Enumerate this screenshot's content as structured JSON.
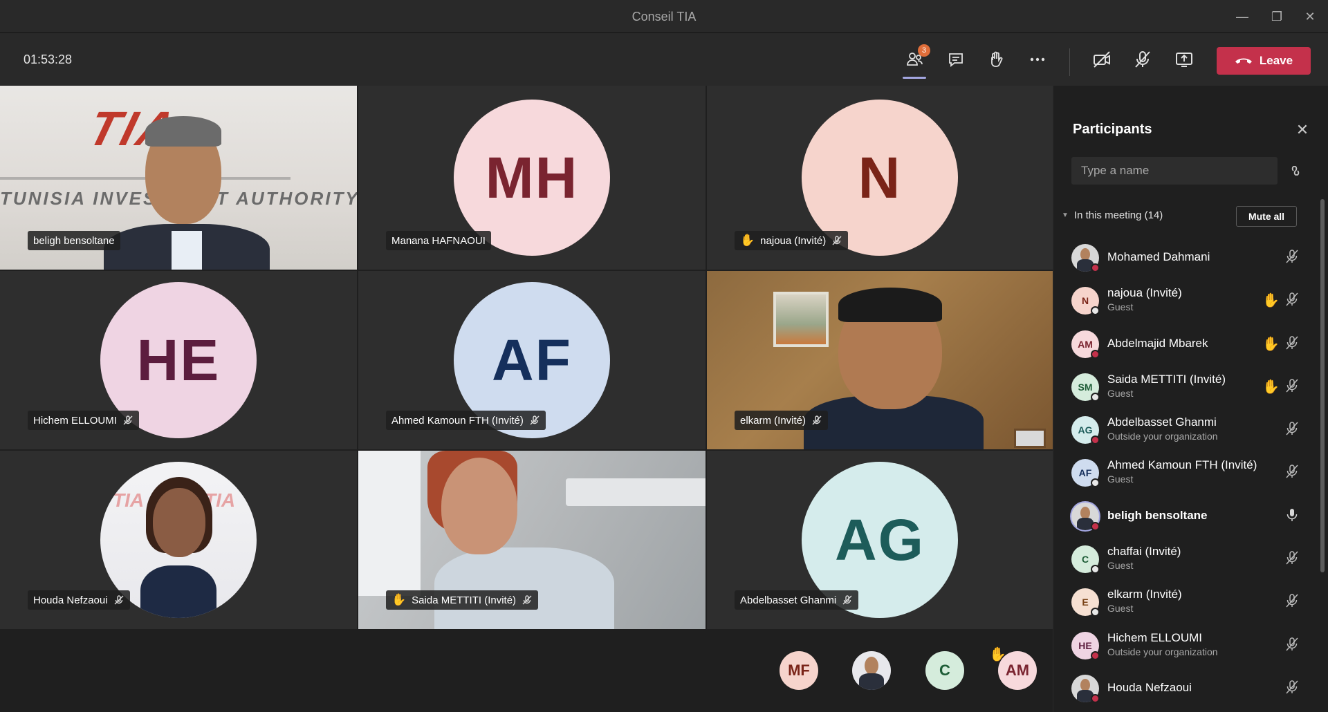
{
  "window": {
    "title": "Conseil TIA"
  },
  "toolbar": {
    "timer": "01:53:28",
    "participants_badge": "3",
    "leave_label": "Leave",
    "icons": [
      "people-icon",
      "chat-icon",
      "raise-hand-icon",
      "more-icon",
      "camera-off-icon",
      "mic-off-icon",
      "share-screen-icon",
      "phone-hangup-icon"
    ]
  },
  "grid": {
    "tiles": [
      {
        "name": "beligh bensoltane",
        "type": "video",
        "muted": false,
        "hand": false
      },
      {
        "name": "Manana HAFNAOUI",
        "type": "avatar",
        "initials": "MH",
        "bg": "#f7d9dc",
        "fg": "#7a2430",
        "muted": false,
        "hand": false
      },
      {
        "name": "najoua (Invité)",
        "type": "avatar",
        "initials": "N",
        "bg": "#f6d4cc",
        "fg": "#7a2418",
        "muted": true,
        "hand": true
      },
      {
        "name": "Hichem ELLOUMI",
        "type": "avatar",
        "initials": "HE",
        "bg": "#efd4e3",
        "fg": "#5c1d3e",
        "muted": true,
        "hand": false
      },
      {
        "name": "Ahmed Kamoun FTH (Invité)",
        "type": "avatar",
        "initials": "AF",
        "bg": "#cfdcef",
        "fg": "#152f5c",
        "muted": true,
        "hand": false
      },
      {
        "name": "elkarm (Invité)",
        "type": "video",
        "muted": true,
        "hand": false
      },
      {
        "name": "Houda Nefzaoui",
        "type": "photo",
        "muted": true,
        "hand": false
      },
      {
        "name": "Saida METTITI (Invité)",
        "type": "video",
        "muted": true,
        "hand": true
      },
      {
        "name": "Abdelbasset Ghanmi",
        "type": "avatar",
        "initials": "AG",
        "bg": "#d5ecec",
        "fg": "#1d5c5a",
        "muted": true,
        "hand": false
      }
    ],
    "tia_logo_text": "TIA",
    "tia_sub_text": "TUNISIA INVESTMENT AUTHORITY"
  },
  "strip": {
    "avatars": [
      {
        "initials": "MF",
        "bg": "#f6d4cc",
        "fg": "#7a2418",
        "hand": false
      },
      {
        "initials": "",
        "bg": "#e8e8ec",
        "fg": "#333",
        "hand": false,
        "photo": true
      },
      {
        "initials": "C",
        "bg": "#d5ecdc",
        "fg": "#1d5c36",
        "hand": false
      },
      {
        "initials": "AM",
        "bg": "#f7d9dc",
        "fg": "#7a2430",
        "hand": true
      }
    ]
  },
  "panel": {
    "title": "Participants",
    "search_placeholder": "Type a name",
    "section_label": "In this meeting (14)",
    "mute_all_label": "Mute all",
    "participants": [
      {
        "name": "Mohamed Dahmani",
        "sub": "",
        "initials": "",
        "photo": true,
        "bg": "#d8d8d8",
        "fg": "#333",
        "status": "#c4314b",
        "hand": false,
        "mic": "off",
        "bold": false
      },
      {
        "name": "najoua (Invité)",
        "sub": "Guest",
        "initials": "N",
        "bg": "#f6d4cc",
        "fg": "#7a2418",
        "status": "#e8e8e8",
        "hand": true,
        "mic": "off",
        "bold": false
      },
      {
        "name": "Abdelmajid Mbarek",
        "sub": "",
        "initials": "AM",
        "bg": "#f7d9dc",
        "fg": "#7a2430",
        "status": "#c4314b",
        "hand": true,
        "mic": "off",
        "bold": false
      },
      {
        "name": "Saida METTITI (Invité)",
        "sub": "Guest",
        "initials": "SM",
        "bg": "#d5ecdc",
        "fg": "#1d5c36",
        "status": "#e8e8e8",
        "hand": true,
        "mic": "off",
        "bold": false
      },
      {
        "name": "Abdelbasset Ghanmi",
        "sub": "Outside your organization",
        "initials": "AG",
        "bg": "#d5ecec",
        "fg": "#1d5c5a",
        "status": "#c4314b",
        "hand": false,
        "mic": "off",
        "bold": false
      },
      {
        "name": "Ahmed Kamoun FTH (Invité)",
        "sub": "Guest",
        "initials": "AF",
        "bg": "#cfdcef",
        "fg": "#152f5c",
        "status": "#e8e8e8",
        "hand": false,
        "mic": "off",
        "bold": false
      },
      {
        "name": "beligh bensoltane",
        "sub": "",
        "initials": "",
        "photo": true,
        "bg": "#d8d8d8",
        "fg": "#333",
        "status": "#c4314b",
        "hand": false,
        "mic": "on",
        "bold": true
      },
      {
        "name": "chaffai (Invité)",
        "sub": "Guest",
        "initials": "C",
        "bg": "#d5ecdc",
        "fg": "#1d5c36",
        "status": "#e8e8e8",
        "hand": false,
        "mic": "off",
        "bold": false
      },
      {
        "name": "elkarm (Invité)",
        "sub": "Guest",
        "initials": "E",
        "bg": "#f6e0d2",
        "fg": "#7a4418",
        "status": "#e8e8e8",
        "hand": false,
        "mic": "off",
        "bold": false
      },
      {
        "name": "Hichem ELLOUMI",
        "sub": "Outside your organization",
        "initials": "HE",
        "bg": "#efd4e3",
        "fg": "#5c1d3e",
        "status": "#c4314b",
        "hand": false,
        "mic": "off",
        "bold": false
      },
      {
        "name": "Houda Nefzaoui",
        "sub": "",
        "initials": "",
        "photo": true,
        "bg": "#d8d8d8",
        "fg": "#333",
        "status": "#c4314b",
        "hand": false,
        "mic": "off",
        "bold": false
      }
    ]
  },
  "colors": {
    "leave": "#c4314b",
    "accent": "#a3a6e0",
    "hand": "#f4b400",
    "badge": "#e06e3a"
  }
}
